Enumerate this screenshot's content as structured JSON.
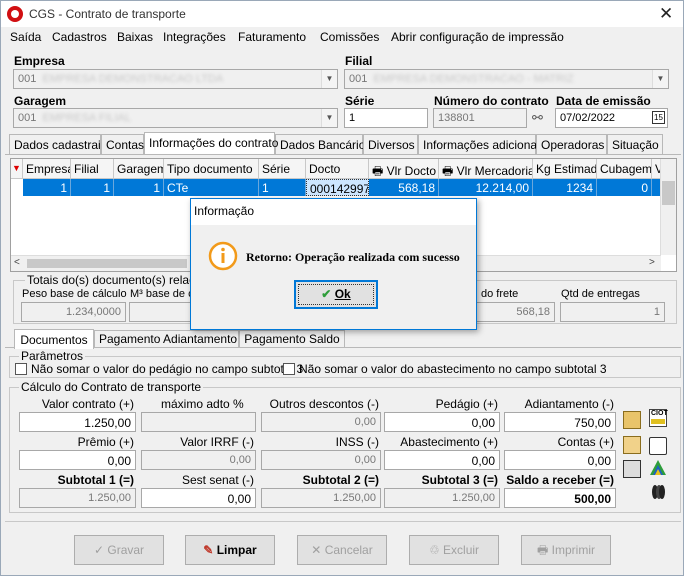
{
  "window": {
    "title": "CGS - Contrato de transporte"
  },
  "menu": [
    "Saída",
    "Cadastros",
    "Baixas",
    "Integrações",
    "Faturamento",
    "Comissões",
    "Abrir configuração de impressão"
  ],
  "form": {
    "empresa_label": "Empresa",
    "empresa_value": "001",
    "filial_label": "Filial",
    "filial_value": "001",
    "garagem_label": "Garagem",
    "garagem_value": "001",
    "serie_label": "Série",
    "serie_value": "1",
    "numero_label": "Número do contrato",
    "numero_value": "138801",
    "emissao_label": "Data de emissão",
    "emissao_value": "07/02/2022"
  },
  "tabs": [
    "Dados cadastrais",
    "Contas",
    "Informações do contrato",
    "Dados Bancários",
    "Diversos",
    "Informações adicionais",
    "Operadoras",
    "Situação"
  ],
  "grid": {
    "columns": [
      "Empresa",
      "Filial",
      "Garagem",
      "Tipo documento",
      "Série",
      "Docto",
      "Vlr Docto",
      "Vlr Mercadoria",
      "Kg Estimado",
      "Cubagem",
      "V"
    ],
    "row": [
      "1",
      "1",
      "1",
      "CTe",
      "1",
      "000142997",
      "568,18",
      "12.214,00",
      "1234",
      "0"
    ]
  },
  "totals": {
    "legend": "Totais do(s) documento(s) relaciona",
    "peso_label": "Peso base de cálculo",
    "peso_value": "1.234,0000",
    "m3_label": "M³ base de c",
    "frete_label": "do frete",
    "frete_value": "568,18",
    "entregas_label": "Qtd de entregas",
    "entregas_value": "1"
  },
  "subtabs": [
    "Documentos",
    "Pagamento Adiantamento",
    "Pagamento Saldo"
  ],
  "params": {
    "legend": "Parâmetros",
    "pedagio": "Não somar o valor do pedágio no campo subtotal 3",
    "abastecimento": "Não somar o valor do abastecimento no campo subtotal 3"
  },
  "calc": {
    "legend": "Cálculo do Contrato de transporte",
    "valor_contrato_label": "Valor contrato (+)",
    "valor_contrato": "1.250,00",
    "max_adto_label": "máximo adto %",
    "max_adto": "",
    "outros_label": "Outros descontos (-)",
    "outros": "0,00",
    "pedagio_label": "Pedágio (+)",
    "pedagio": "0,00",
    "adiantamento_label": "Adiantamento (-)",
    "adiantamento": "750,00",
    "premio_label": "Prêmio (+)",
    "premio": "0,00",
    "irrf_label": "Valor IRRF (-)",
    "irrf": "0,00",
    "inss_label": "INSS (-)",
    "inss": "0,00",
    "abast_label": "Abastecimento (+)",
    "abast": "0,00",
    "contas_label": "Contas (+)",
    "contas": "0,00",
    "sub1_label": "Subtotal 1 (=)",
    "sub1": "1.250,00",
    "sest_label": "Sest senat (-)",
    "sest": "0,00",
    "sub2_label": "Subtotal 2 (=)",
    "sub2": "1.250,00",
    "sub3_label": "Subtotal 3 (=)",
    "sub3": "1.250,00",
    "saldo_label": "Saldo a receber (=)",
    "saldo": "500,00",
    "ciot_label": "CIOT"
  },
  "buttons": {
    "gravar": "Gravar",
    "limpar": "Limpar",
    "cancelar": "Cancelar",
    "excluir": "Excluir",
    "imprimir": "Imprimir"
  },
  "dialog": {
    "title": "Informação",
    "message": "Retorno: Operação realizada com sucesso",
    "ok": "Ok"
  }
}
